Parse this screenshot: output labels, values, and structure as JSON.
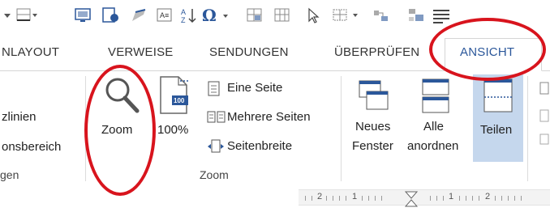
{
  "tabs": [
    {
      "label": "NLAYOUT"
    },
    {
      "label": "VERWEISE"
    },
    {
      "label": "SENDUNGEN"
    },
    {
      "label": "ÜBERPRÜFEN"
    },
    {
      "label": "ANSICHT",
      "active": true
    }
  ],
  "ribbon": {
    "left_partial": {
      "line1": "zlinien",
      "line2": "onsbereich",
      "group_label": "gen"
    },
    "zoom_group": {
      "zoom_label": "Zoom",
      "hundred_label": "100%",
      "hundred_icon_badge": "100",
      "eine_seite": "Eine Seite",
      "mehrere_seiten": "Mehrere Seiten",
      "seitenbreite": "Seitenbreite",
      "group_label": "Zoom"
    },
    "window_group": {
      "neues_line1": "Neues",
      "neues_line2": "Fenster",
      "alle_line1": "Alle",
      "alle_line2": "anordnen",
      "teilen": "Teilen"
    }
  },
  "ruler": {
    "numbers": [
      "2",
      "1",
      "1",
      "2"
    ]
  },
  "colors": {
    "accent": "#2b579a",
    "annotation_red": "#d8141d",
    "selected_button": "#c5d7ed"
  }
}
